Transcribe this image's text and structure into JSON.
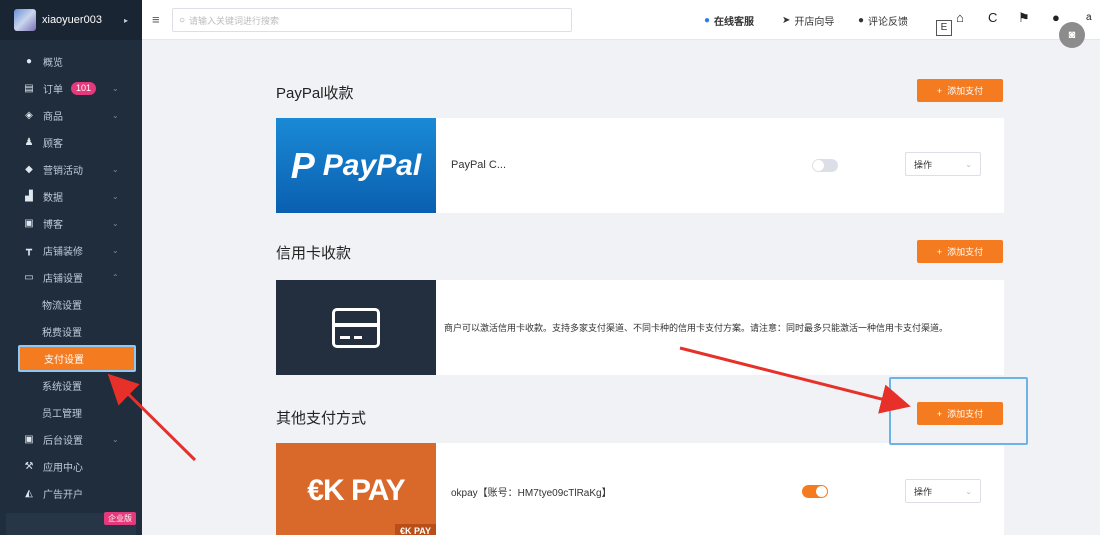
{
  "sidebar": {
    "username": "xiaoyuer003",
    "items": [
      {
        "label": "概览",
        "icon": "dashboard-icon"
      },
      {
        "label": "订单",
        "icon": "order-icon",
        "badge": "101"
      },
      {
        "label": "商品",
        "icon": "goods-icon"
      },
      {
        "label": "顾客",
        "icon": "user-icon"
      },
      {
        "label": "营销活动",
        "icon": "tag-icon"
      },
      {
        "label": "数据",
        "icon": "chart-icon"
      },
      {
        "label": "博客",
        "icon": "blog-icon"
      },
      {
        "label": "店铺装修",
        "icon": "paint-icon"
      },
      {
        "label": "店铺设置",
        "icon": "store-settings-icon"
      }
    ],
    "sub_items": [
      "物流设置",
      "税费设置",
      "支付设置",
      "系统设置",
      "员工管理"
    ],
    "bottom_items": [
      {
        "label": "后台设置",
        "icon": "monitor-icon"
      },
      {
        "label": "应用中心",
        "icon": "wrench-icon"
      },
      {
        "label": "广告开户",
        "icon": "ads-icon"
      }
    ],
    "edition_badge": "企业版"
  },
  "topbar": {
    "search_placeholder": "请输入关键词进行搜索",
    "service": "在线客服",
    "guide": "开店向导",
    "feedback": "评论反馈",
    "e_label": "E",
    "trailing": "a"
  },
  "sections": {
    "paypal": {
      "title": "PayPal收款",
      "add_label": "添加支付",
      "logo_text": "PayPal",
      "name": "PayPal C...",
      "enabled": false,
      "op_label": "操作"
    },
    "credit": {
      "title": "信用卡收款",
      "add_label": "添加支付",
      "desc": "商户可以激活信用卡收款。支持多家支付渠道、不同卡种的信用卡支付方案。请注意：同时最多只能激活一种信用卡支付渠道。"
    },
    "other": {
      "title": "其他支付方式",
      "add_label": "添加支付",
      "logo_text": "€K PAY",
      "logo_corner": "€K PAY",
      "name": "okpay【账号：HM7tye09cTlRaKg】",
      "enabled": true,
      "op_label": "操作"
    }
  },
  "colors": {
    "accent": "#f47b20",
    "sidebar_bg": "#1f2d3d",
    "highlight": "#6db3e8",
    "arrow": "#e8302a"
  }
}
